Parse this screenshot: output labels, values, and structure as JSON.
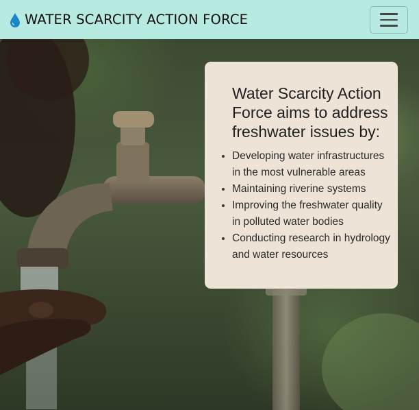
{
  "navbar": {
    "brand_icon": "water-drop-icon",
    "brand_text": "WATER SCARCITY ACTION FORCE",
    "toggler_icon": "hamburger-menu-icon",
    "background": "#b7ebe1"
  },
  "info_card": {
    "title": "Water Scarcity Action Force aims to address freshwater issues by:",
    "items": [
      "Developing water infrastructures in the most vulnerable areas",
      "Maintaining riverine systems",
      "Improving the freshwater quality in polluted water bodies",
      "Conducting research in hydrology and water resources"
    ],
    "background": "#ede3d6"
  },
  "hero": {
    "image_subject": "hands-under-water-tap-photo"
  }
}
